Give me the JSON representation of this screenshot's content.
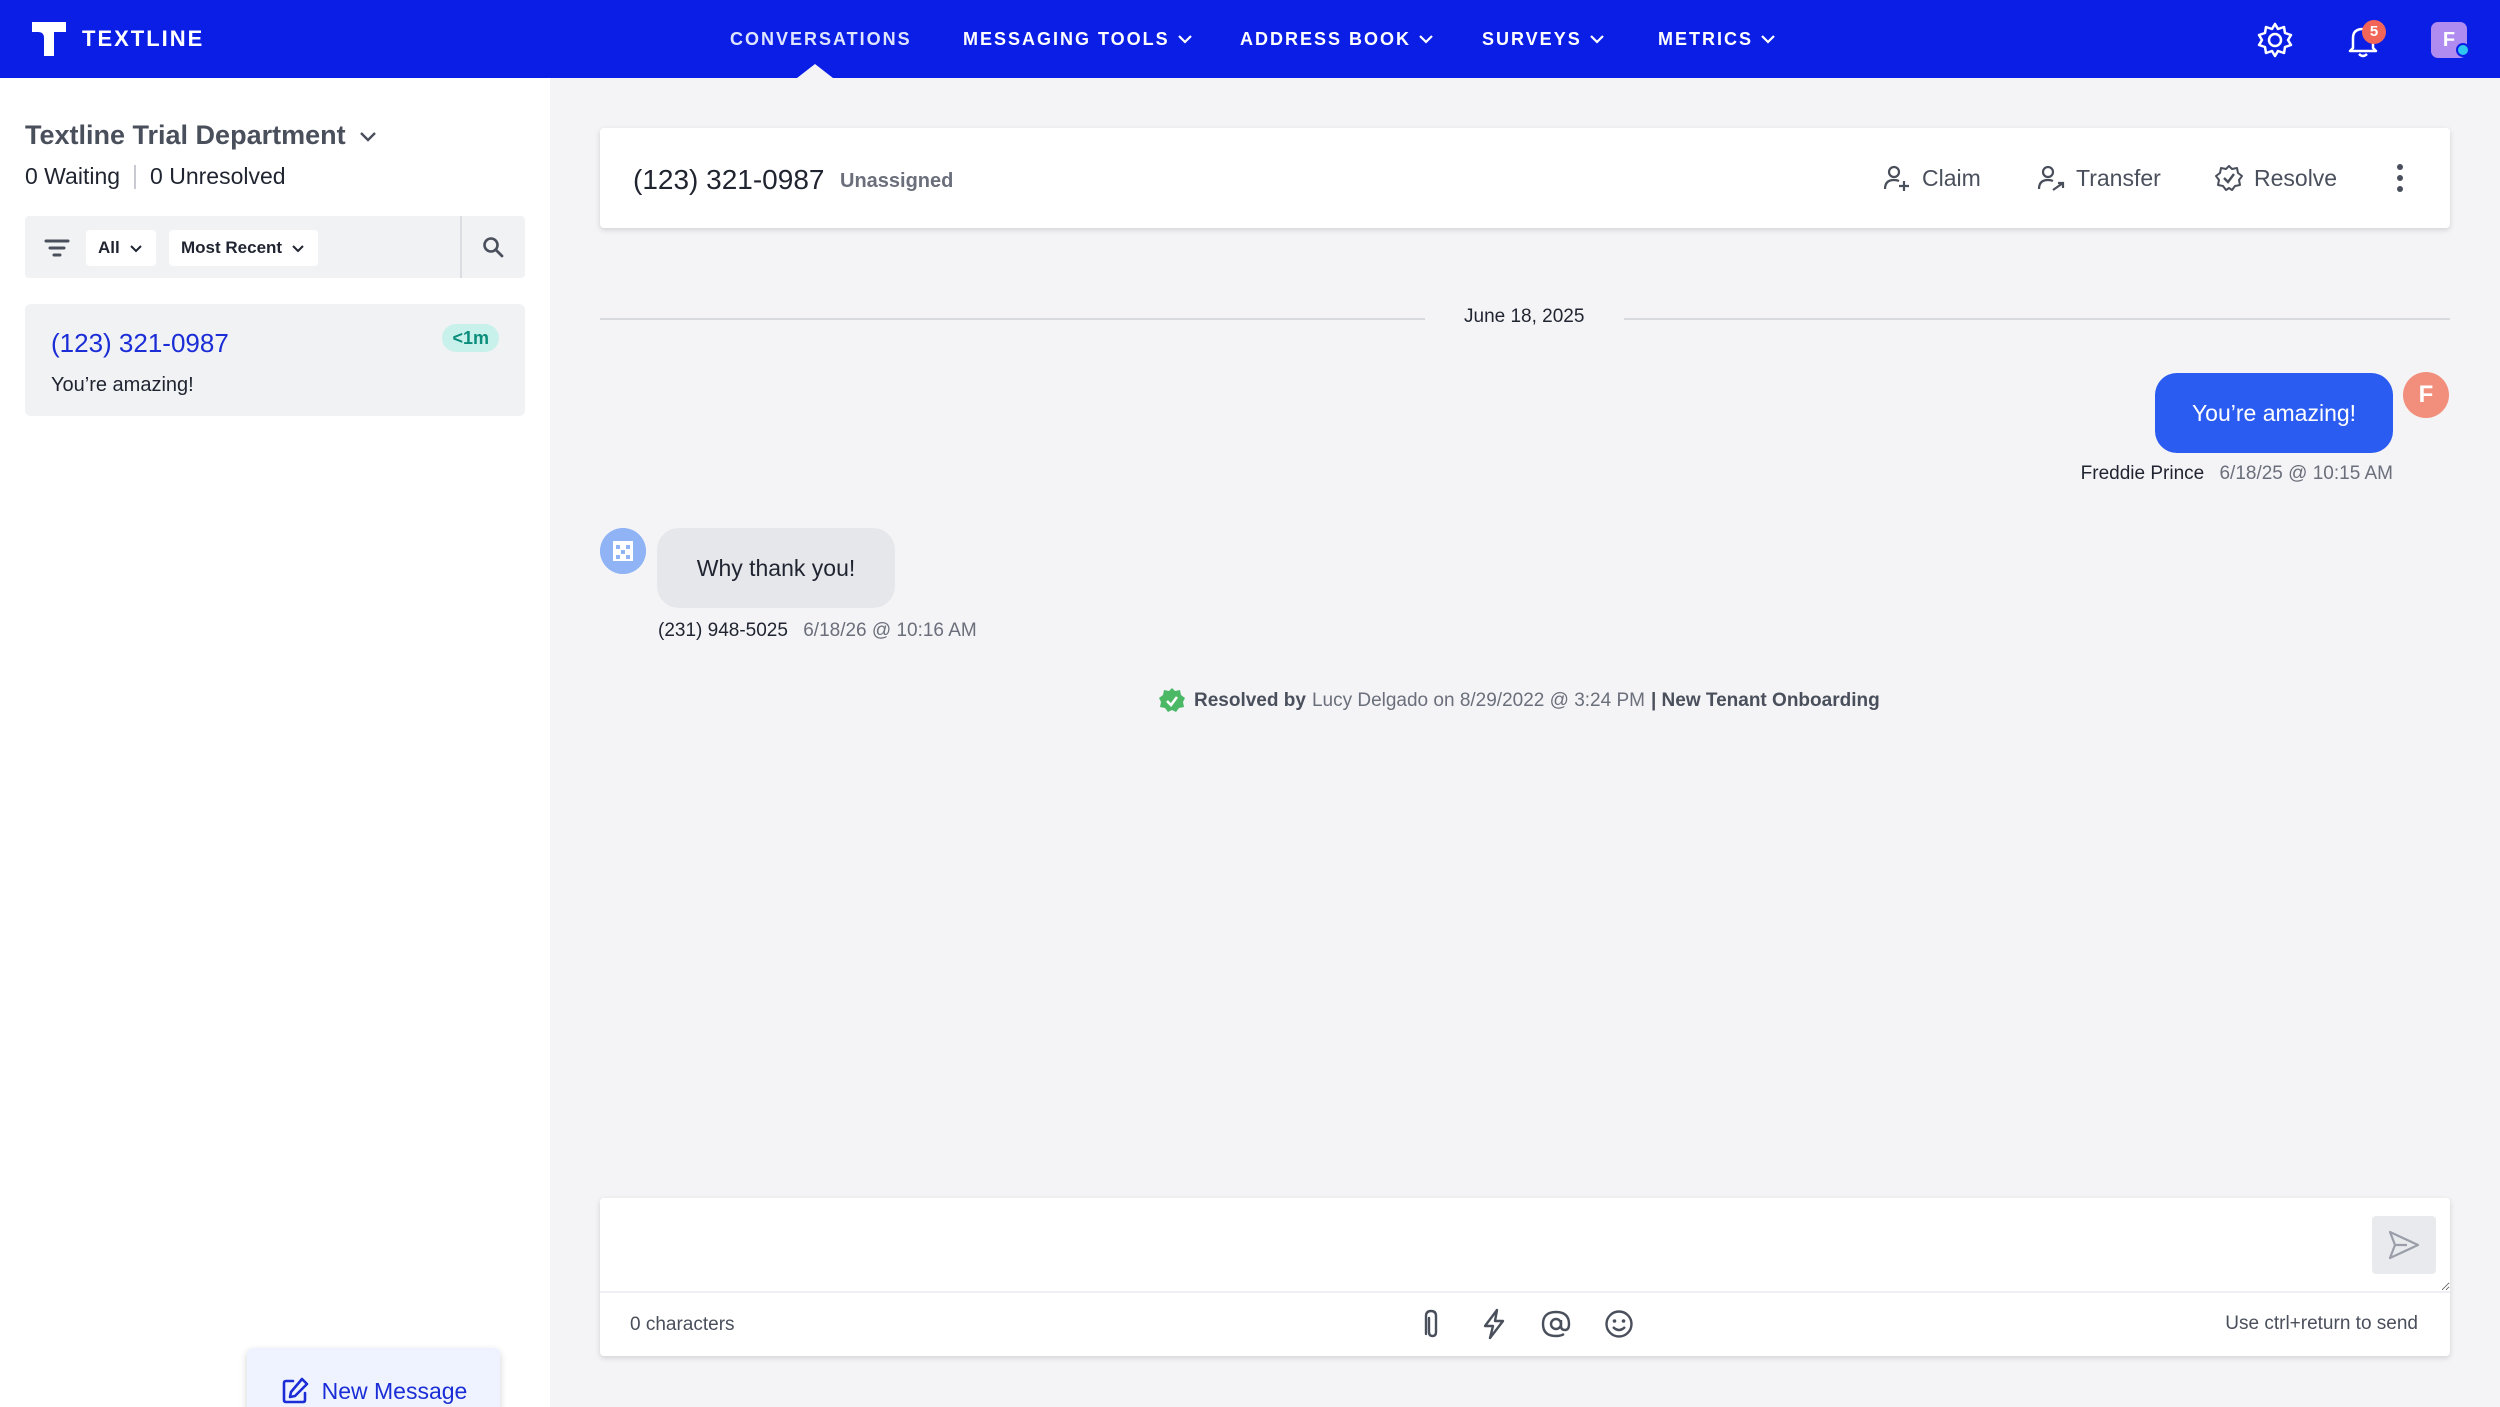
{
  "app": {
    "name": "TEXTLINE"
  },
  "nav": {
    "items": [
      {
        "label": "CONVERSATIONS",
        "active": true
      },
      {
        "label": "MESSAGING TOOLS"
      },
      {
        "label": "ADDRESS BOOK"
      },
      {
        "label": "SURVEYS"
      },
      {
        "label": "METRICS"
      }
    ],
    "notification_count": "5",
    "user_initial": "F"
  },
  "sidebar": {
    "department": "Textline Trial Department",
    "waiting": "0 Waiting",
    "unresolved": "0 Unresolved",
    "filter_all": "All",
    "filter_sort": "Most Recent",
    "conversations": [
      {
        "phone": "(123) 321-0987",
        "time": "<1m",
        "preview": "You’re amazing!"
      }
    ],
    "new_message": "New Message"
  },
  "conversation": {
    "phone": "(123) 321-0987",
    "assignment": "Unassigned",
    "actions": {
      "claim": "Claim",
      "transfer": "Transfer",
      "resolve": "Resolve"
    },
    "date": "June 18, 2025",
    "messages": [
      {
        "direction": "out",
        "text": "You’re amazing!",
        "sender": "Freddie Prince",
        "timestamp": "6/18/25 @ 10:15 AM",
        "avatar": "F"
      },
      {
        "direction": "in",
        "text": "Why thank you!",
        "sender": "(231) 948-5025",
        "timestamp": "6/18/26 @ 10:16 AM"
      }
    ],
    "resolution": {
      "prefix": "Resolved by",
      "detail": "Lucy Delgado on 8/29/2022 @ 3:24 PM",
      "tag": "| New Tenant Onboarding"
    }
  },
  "composer": {
    "value": "",
    "char_count": "0 characters",
    "hint": "Use ctrl+return to send"
  },
  "colors": {
    "brand": "#0a1ee6",
    "outgoing_bubble": "#2b5cf2",
    "link": "#1a2dd6",
    "resolved_green": "#4bb866"
  }
}
